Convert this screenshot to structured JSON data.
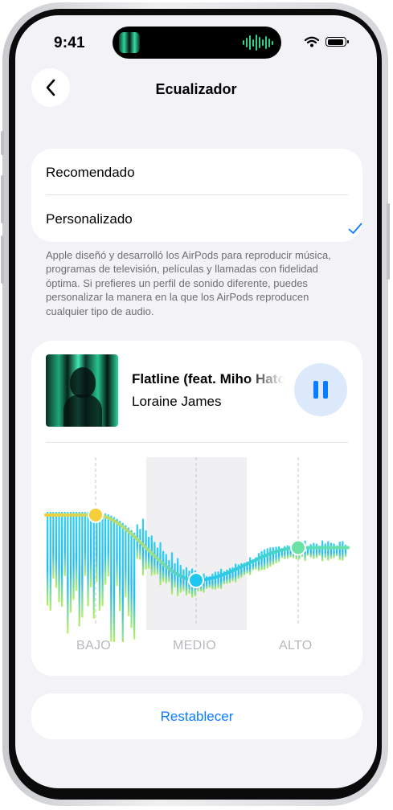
{
  "status_bar": {
    "time": "9:41"
  },
  "nav": {
    "title": "Ecualizador",
    "back_icon": "chevron-left-icon"
  },
  "profile": {
    "options": [
      {
        "label": "Recomendado",
        "selected": false
      },
      {
        "label": "Personalizado",
        "selected": true
      }
    ],
    "footnote": "Apple diseñó y desarrolló los AirPods para reproducir música, programas de televisión, películas y llamadas con fidelidad óptima. Si prefieres un perfil de sonido diferente, puedes personalizar la manera en la que los AirPods reproducen cualquier tipo de audio."
  },
  "player": {
    "song": "Flatline (feat. Miho Hatori)",
    "artist": "Loraine James",
    "state_icon": "pause-icon"
  },
  "equalizer": {
    "bands": [
      "BAJO",
      "MEDIO",
      "ALTO"
    ],
    "levels": {
      "bajo": 0.78,
      "medio": 0.22,
      "alto": 0.5
    },
    "colors": {
      "bajo": "#f5cf3b",
      "medio": "#1fc6f0",
      "alto": "#6be3a6"
    }
  },
  "actions": {
    "reset_label": "Restablecer"
  },
  "colors": {
    "accent": "#0a7cff",
    "background": "#f2f2f7",
    "card": "#ffffff"
  }
}
